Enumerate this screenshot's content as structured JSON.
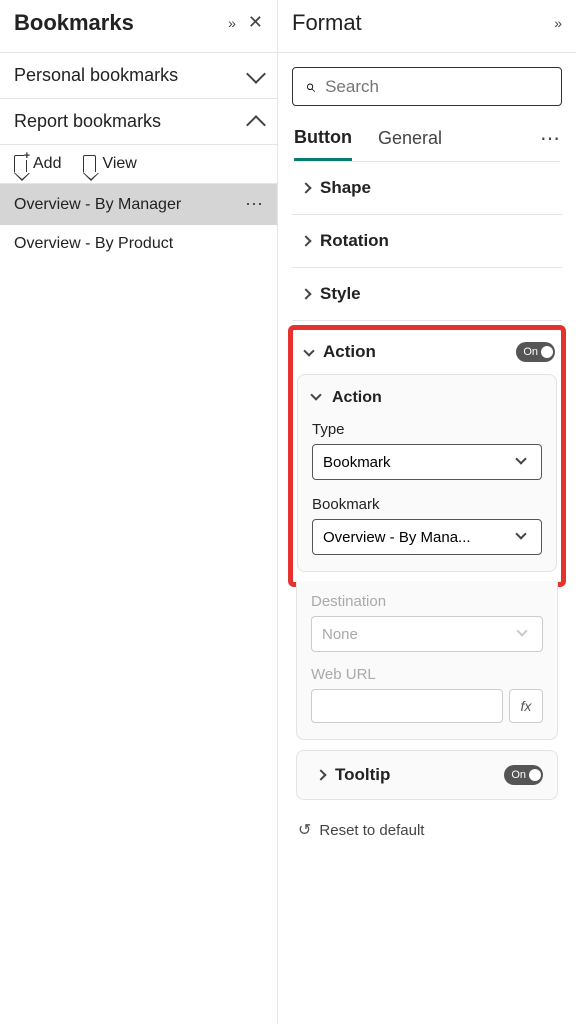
{
  "left": {
    "title": "Bookmarks",
    "sections": {
      "personal": "Personal bookmarks",
      "report": "Report bookmarks"
    },
    "actions": {
      "add": "Add",
      "view": "View"
    },
    "items": [
      {
        "label": "Overview - By Manager",
        "selected": true
      },
      {
        "label": "Overview - By Product",
        "selected": false
      }
    ]
  },
  "right": {
    "title": "Format",
    "search_placeholder": "Search",
    "tabs": {
      "button": "Button",
      "general": "General"
    },
    "rows": {
      "shape": "Shape",
      "rotation": "Rotation",
      "style": "Style",
      "action": "Action",
      "tooltip": "Tooltip"
    },
    "action_card": {
      "header": "Action",
      "type_label": "Type",
      "type_value": "Bookmark",
      "bookmark_label": "Bookmark",
      "bookmark_value": "Overview - By Mana...",
      "destination_label": "Destination",
      "destination_value": "None",
      "weburl_label": "Web URL",
      "fx": "fx"
    },
    "toggle_on": "On",
    "reset": "Reset to default"
  }
}
